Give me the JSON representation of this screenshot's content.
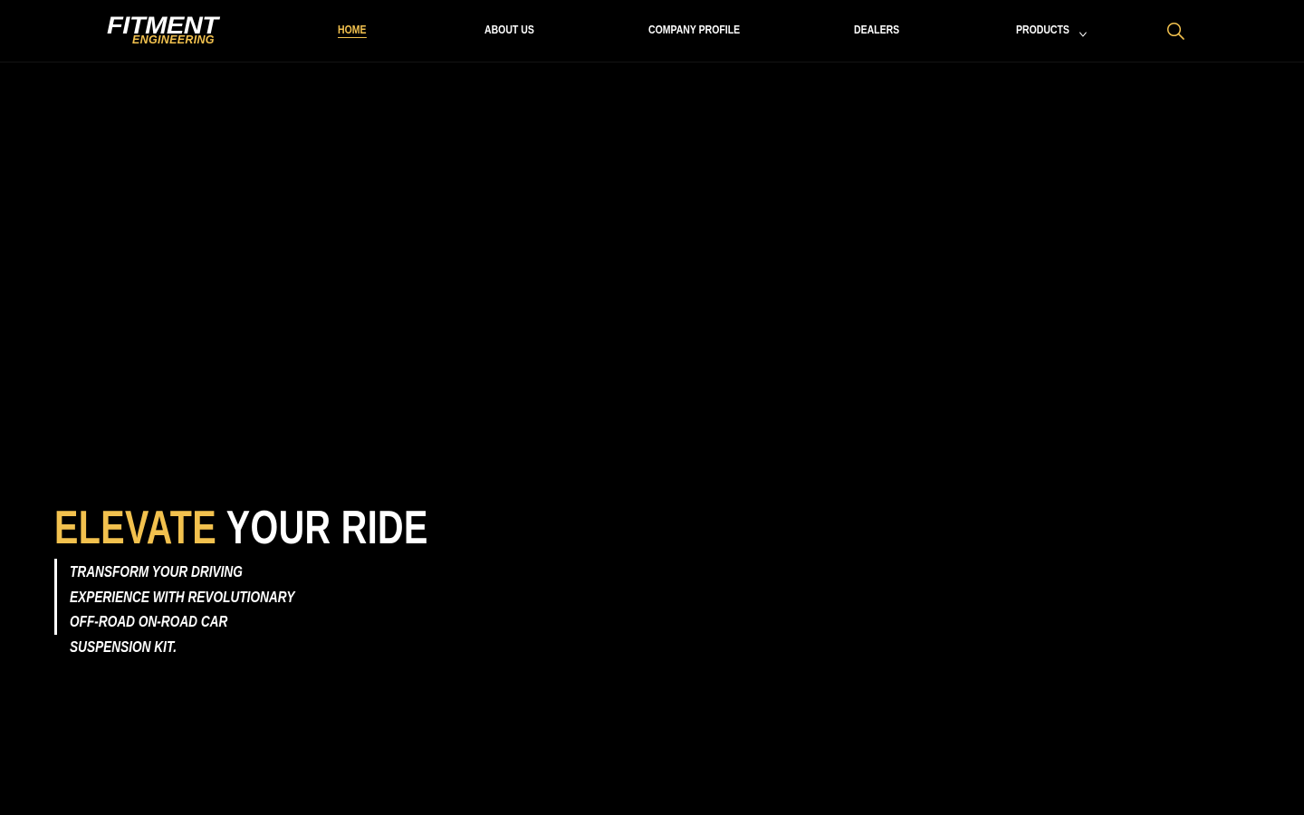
{
  "brand": {
    "name": "FITMENT",
    "tagline": "ENGINEERING",
    "accent_color": "#f2c14e"
  },
  "nav": {
    "items": [
      {
        "label": "HOME",
        "active": true
      },
      {
        "label": "ABOUT US",
        "active": false
      },
      {
        "label": "COMPANY PROFILE",
        "active": false
      },
      {
        "label": "DEALERS",
        "active": false
      },
      {
        "label": "PRODUCTS",
        "active": false,
        "has_dropdown": true,
        "icon": "chevron-down-icon"
      }
    ],
    "search_icon": "search-icon"
  },
  "hero": {
    "title_accent": "ELEVATE",
    "title_rest": "YOUR RIDE",
    "subtitle": "TRANSFORM YOUR DRIVING EXPERIENCE WITH REVOLUTIONARY OFF-ROAD ON-ROAD CAR SUSPENSION KIT.",
    "background_color": "#000000"
  }
}
